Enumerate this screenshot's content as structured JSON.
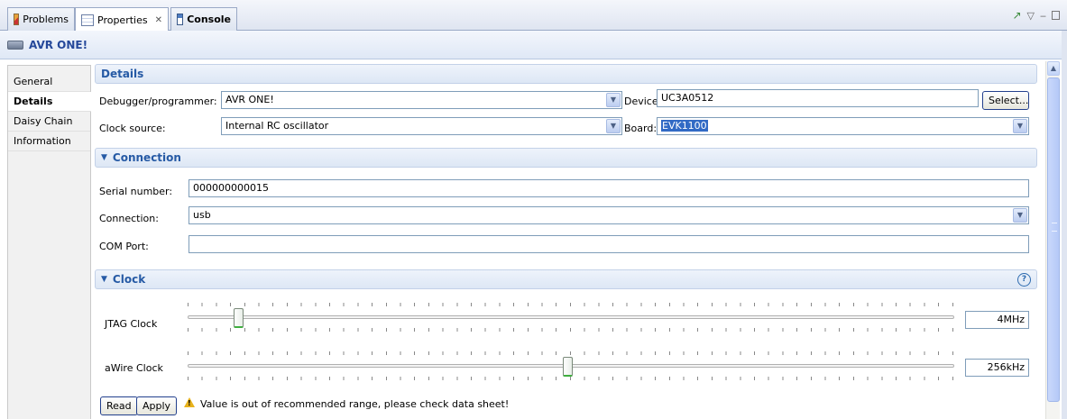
{
  "tabs": [
    {
      "label": "Problems",
      "icon": "problems-icon"
    },
    {
      "label": "Properties",
      "icon": "properties-icon",
      "close": "✕"
    },
    {
      "label": "Console",
      "icon": "console-icon"
    }
  ],
  "title": "AVR ONE!",
  "nav": [
    "General",
    "Details",
    "Daisy Chain",
    "Information"
  ],
  "details": {
    "header": "Details",
    "debugger_label": "Debugger/programmer:",
    "debugger_value": "AVR ONE!",
    "device_label": "Device:",
    "device_value": "UC3A0512",
    "select_button": "Select...",
    "clock_source_label": "Clock source:",
    "clock_source_value": "Internal RC oscillator",
    "board_label": "Board:",
    "board_value": "EVK1100"
  },
  "connection": {
    "header": "Connection",
    "serial_label": "Serial number:",
    "serial_value": "000000000015",
    "connection_label": "Connection:",
    "connection_value": "usb",
    "com_port_label": "COM Port:",
    "com_port_value": ""
  },
  "clock": {
    "header": "Clock",
    "jtag_label": "JTAG Clock",
    "jtag_value": "4MHz",
    "jtag_position": 0.066,
    "awire_label": "aWire Clock",
    "awire_value": "256kHz",
    "awire_position": 0.496,
    "read_button": "Read",
    "apply_button": "Apply",
    "warning": "Value is out of recommended range, please check data sheet!"
  },
  "colors": {
    "accent": "#265aa5",
    "warning": "#e8b21b",
    "selection": "#316ac5",
    "thumb_indicator": "#3fae3f"
  }
}
